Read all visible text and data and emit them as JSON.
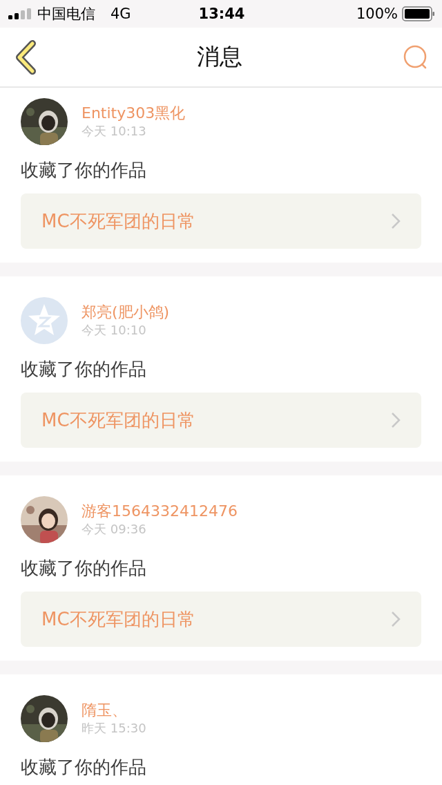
{
  "status_bar": {
    "carrier": "中国电信",
    "network": "4G",
    "time": "13:44",
    "battery": "100%"
  },
  "header": {
    "title": "消息"
  },
  "messages": [
    {
      "name": "Entity303黑化",
      "time": "今天 10:13",
      "action": "收藏了你的作品",
      "work": "MC不死军团的日常"
    },
    {
      "avatar": {
        "kind": "default"
      },
      "name": "郑亮(肥小鸽)",
      "time": "今天 10:10",
      "action": "收藏了你的作品",
      "work": "MC不死军团的日常"
    },
    {
      "name": "游客1564332412476",
      "time": "今天 09:36",
      "action": "收藏了你的作品",
      "work": "MC不死军团的日常"
    },
    {
      "name": "隋玉、",
      "time": "昨天 15:30",
      "action": "收藏了你的作品"
    }
  ]
}
